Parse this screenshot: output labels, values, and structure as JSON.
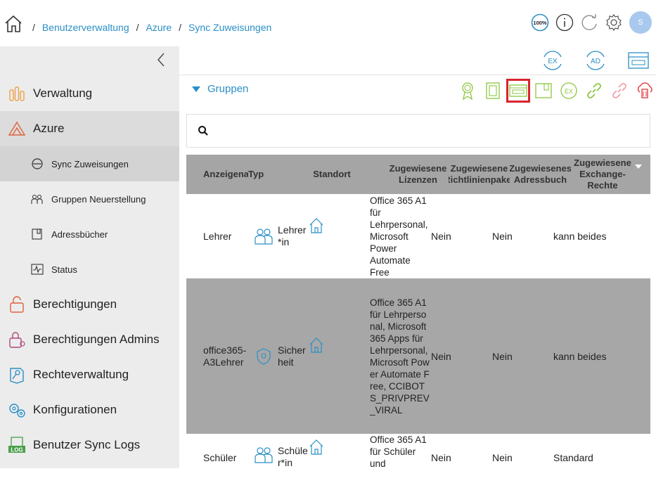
{
  "breadcrumb": {
    "sep": "/",
    "items": [
      "Benutzerverwaltung",
      "Azure",
      "Sync Zuweisungen"
    ]
  },
  "header_icons": [
    "zoom-100-icon",
    "info-icon",
    "refresh-icon",
    "settings-icon"
  ],
  "zoom_label": "100%",
  "user": {
    "initial": "S",
    "color": "#a9c8ee"
  },
  "sidebar": {
    "items": [
      {
        "label": "Verwaltung",
        "icon": "verwaltung-icon"
      },
      {
        "label": "Azure",
        "icon": "azure-icon",
        "active": true
      },
      {
        "label": "Sync Zuweisungen",
        "icon": "sync-icon",
        "sub": true,
        "active": true
      },
      {
        "label": "Gruppen Neuerstellung",
        "icon": "group-rebuild-icon",
        "sub": true
      },
      {
        "label": "Adressbücher",
        "icon": "addressbook-icon",
        "sub": true
      },
      {
        "label": "Status",
        "icon": "status-icon",
        "sub": true
      },
      {
        "label": "Berechtigungen",
        "icon": "lock-icon"
      },
      {
        "label": "Berechtigungen Admins",
        "icon": "admin-lock-icon"
      },
      {
        "label": "Rechteverwaltung",
        "icon": "key-icon"
      },
      {
        "label": "Konfigurationen",
        "icon": "gears-icon"
      },
      {
        "label": "Benutzer Sync Logs",
        "icon": "log-icon"
      }
    ]
  },
  "main": {
    "top_buttons": {
      "ex": "EX",
      "ad": "AD"
    },
    "section_title": "Gruppen",
    "tools": [
      "certificate-icon",
      "license-icon",
      "policy-icon",
      "addressbook-icon",
      "exchange-icon",
      "link-icon",
      "unlink-icon",
      "delete-cloud-icon"
    ],
    "tool_ex_label": "EX"
  },
  "table": {
    "headers": [
      "Anzeigename",
      "Typ",
      "Standort",
      "Zugewiesene Lizenzen",
      "Zugewiesene Richtlinienpaket",
      "Zugewiesenes Adressbuch",
      "Zugewiesene Exchange-Rechte"
    ],
    "rows": [
      {
        "name": "Lehrer",
        "type": "Lehrer\n*in",
        "licenses": "Office 365 A1 für Lehrpersonal, Microsoft Power Automate Free",
        "policy": "Nein",
        "addressbook": "Nein",
        "exchange": "kann beides"
      },
      {
        "name": "office365-A3Lehrer",
        "type": "Sicher heit",
        "licenses": "Office 365 A1 für Lehrpersonal, Microsoft 365 Apps für Lehrpersonal, Microsoft Power Automate Free, CCIBOTS_PRIVPREV_VIRAL",
        "policy": "Nein",
        "addressbook": "Nein",
        "exchange": "kann beides"
      },
      {
        "name": "Schüler",
        "type": "Schüle r*in",
        "licenses": "Office 365 A1 für Schüler und",
        "policy": "Nein",
        "addressbook": "Nein",
        "exchange": "Standard"
      }
    ]
  },
  "colors": {
    "link": "#2a8fc6",
    "green": "#8dc63f",
    "red": "#e0323c",
    "header": "#a5a5a5"
  }
}
